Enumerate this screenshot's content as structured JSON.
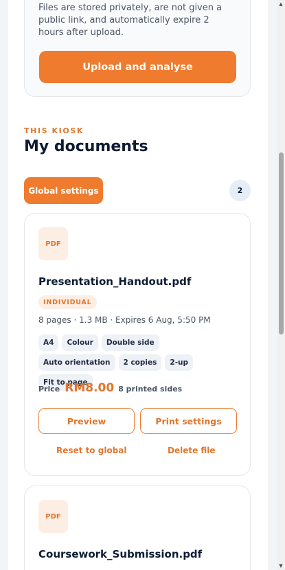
{
  "upload": {
    "text": "Files are stored privately, are not given a public link, and automatically expire 2 hours after upload.",
    "button_label": "Upload and analyse"
  },
  "section": {
    "eyebrow": "THIS KIOSK",
    "title": "My documents",
    "global_settings_label": "Global settings",
    "document_count": "2"
  },
  "documents": [
    {
      "thumb_label": "PDF",
      "name": "Presentation_Handout.pdf",
      "mode": "INDIVIDUAL",
      "meta": "8 pages · 1.3 MB · Expires 6 Aug, 5:50 PM",
      "chips": [
        "A4",
        "Colour",
        "Double side",
        "Auto orientation",
        "2 copies",
        "2-up",
        "Fit to page"
      ],
      "price_label": "Price",
      "price": "RM8.00",
      "printed_sides": "8 printed sides",
      "preview_label": "Preview",
      "print_settings_label": "Print settings",
      "reset_label": "Reset to global",
      "delete_label": "Delete file"
    },
    {
      "thumb_label": "PDF",
      "name": "Coursework_Submission.pdf"
    }
  ],
  "colors": {
    "accent": "#ef7b2f",
    "accent_text": "#e0762d",
    "accent_soft": "#fdeee4",
    "text_primary": "#0f1b33",
    "text_secondary": "#4b5563"
  },
  "icons": {
    "scroll_up": "triangle-up-icon",
    "scroll_down": "triangle-down-icon"
  }
}
